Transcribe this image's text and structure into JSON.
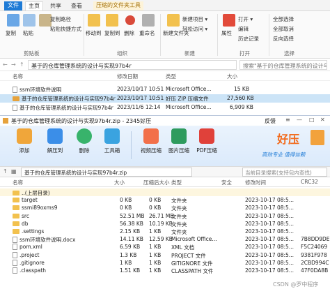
{
  "explorer": {
    "tabs": [
      "文件",
      "主页",
      "共享",
      "查看",
      "压缩的文件夹工具"
    ],
    "ribbon": {
      "clipboard": {
        "pin": "固定到快速访问",
        "copy": "复制",
        "paste": "粘贴",
        "copy_path": "复制路径",
        "paste_shortcut": "粘贴快捷方式",
        "cut": "剪切",
        "group": "剪贴板"
      },
      "organize": {
        "move_to": "移动到",
        "copy_to": "复制到",
        "delete": "删除",
        "rename": "重命名",
        "group": "组织"
      },
      "new": {
        "new_folder": "新建文件夹",
        "new_item": "新建项目 ▾",
        "easy_access": "轻松访问 ▾",
        "group": "新建"
      },
      "open": {
        "properties": "属性",
        "open": "打开 ▾",
        "edit": "编辑",
        "history": "历史记录",
        "group": "打开"
      },
      "select": {
        "select_all": "全部选择",
        "select_none": "全部取消",
        "invert": "反向选择",
        "group": "选择"
      }
    },
    "address": "基于的仓库管理系统的设计与实现97b4r",
    "search_placeholder": "搜索\"基于的仓库管理系统的设计与实现97b4r\"",
    "columns": {
      "name": "名称",
      "date": "修改日期",
      "type": "类型",
      "size": "大小"
    },
    "files": [
      {
        "name": "ssm环境软件说明",
        "date": "2023/10/17 10:51",
        "type": "Microsoft Office...",
        "size": "15 KB"
      },
      {
        "name": "基于的仓库管理系统的设计与实现97b4r",
        "date": "2023/10/17 10:51",
        "type": "好压 ZIP 压缩文件",
        "size": "27,560 KB"
      },
      {
        "name": "基于的仓库管理系统的设计与实现97b4r",
        "date": "2023/11/6 12:14",
        "type": "Microsoft Office...",
        "size": "6,909 KB"
      }
    ]
  },
  "haozip": {
    "title": "基于的仓库管理系统的设计与实现97b4r.zip - 2345好压",
    "feedback": "反馈",
    "brand": "好压",
    "slogan": "高效专业  值得信赖",
    "toolbar": [
      "添加",
      "解压到",
      "删除",
      "工具箱",
      "视频压缩",
      "图片压缩",
      "PDF压缩"
    ],
    "path": "基于的仓库管理系统的设计与实现97b4r.zip",
    "search_placeholder": "当前目录搜索(支持包内查找)",
    "columns": {
      "name": "名称",
      "size": "大小",
      "packed": "压缩后大小",
      "type": "类型",
      "security": "安全",
      "modified": "修改时间",
      "crc": "CRC32"
    },
    "rows": [
      {
        "name": "..(上层目录)",
        "size": "",
        "packed": "",
        "type": "",
        "modified": "",
        "crc": "",
        "kind": "folder"
      },
      {
        "name": "target",
        "size": "0 KB",
        "packed": "0 KB",
        "type": "文件夹",
        "modified": "2023-10-17 08:5...",
        "crc": "",
        "kind": "folder"
      },
      {
        "name": "ssmi89oxms9",
        "size": "0 KB",
        "packed": "0 KB",
        "type": "文件夹",
        "modified": "2023-10-17 08:5...",
        "crc": "",
        "kind": "folder"
      },
      {
        "name": "src",
        "size": "52.51 MB",
        "packed": "26.71 MB",
        "type": "文件夹",
        "modified": "2023-10-17 08:5...",
        "crc": "",
        "kind": "folder"
      },
      {
        "name": "db",
        "size": "56.38 KB",
        "packed": "10.19 KB",
        "type": "文件夹",
        "modified": "2023-10-17 08:5...",
        "crc": "",
        "kind": "folder"
      },
      {
        "name": ".settings",
        "size": "2.15 KB",
        "packed": "1 KB",
        "type": "文件夹",
        "modified": "2023-10-17 08:5...",
        "crc": "",
        "kind": "folder"
      },
      {
        "name": "ssm环境软件说明.docx",
        "size": "14.11 KB",
        "packed": "12.59 KB",
        "type": "Microsoft Office...",
        "modified": "2023-10-17 08:5...",
        "crc": "7B8DD9DE",
        "kind": "file"
      },
      {
        "name": "pom.xml",
        "size": "6.59 KB",
        "packed": "1 KB",
        "type": "XML 文档",
        "modified": "2023-10-17 08:5...",
        "crc": "F5C24069",
        "kind": "file"
      },
      {
        "name": ".project",
        "size": "1.3 KB",
        "packed": "1 KB",
        "type": "PROJECT 文件",
        "modified": "2023-10-17 08:5...",
        "crc": "9381F978",
        "kind": "file"
      },
      {
        "name": ".gitignore",
        "size": "1 KB",
        "packed": "1 KB",
        "type": "GITIGNORE 文件",
        "modified": "2023-10-17 08:5...",
        "crc": "2CBD994C",
        "kind": "file"
      },
      {
        "name": ".classpath",
        "size": "1.51 KB",
        "packed": "1 KB",
        "type": "CLASSPATH 文件",
        "modified": "2023-10-17 08:5...",
        "crc": "47F0DA8B",
        "kind": "file"
      }
    ],
    "watermark": "CSDN @罗中程序"
  },
  "colors": {
    "accent": "#1e7bd6",
    "context_tab": "#a4720c",
    "selected_row": "#cce4f7",
    "toolbar_bg": "#dbeafb",
    "brand": "#f26a1b"
  }
}
